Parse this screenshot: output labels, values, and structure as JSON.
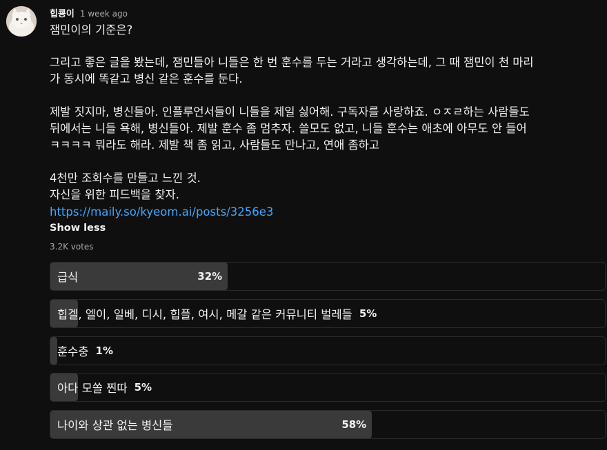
{
  "post": {
    "author": "힙쿙이",
    "time": "1 week ago",
    "lines": [
      {
        "text": "잼민이의 기준은?"
      },
      {
        "text": "그리고 좋은 글을 봤는데, 잼민들아 니들은 한 번 훈수를 두는 거라고 생각하는데, 그 때 잼민이 천 마리"
      },
      {
        "text": "가 동시에 똑같고 병신 같은 훈수를 둔다."
      },
      {
        "text": "제발 짓지마, 병신들아. 인플루언서들이 니들을 제일 싫어해. 구독자를 사랑하죠. ㅇㅈㄹ하는 사람들도"
      },
      {
        "text": "뒤에서는 니들 욕해, 병신들아. 제발 훈수 좀 멈추자. 쓸모도 없고, 니들 훈수는 애초에 아무도 안 들어"
      },
      {
        "text": "ㅋㅋㅋㅋ 뭐라도 해라. 제발 책 좀 읽고, 사람들도 만나고, 연애 좀하고"
      },
      {
        "text": "4천만 조회수를 만들고 느낀 것."
      },
      {
        "text": "자신을 위한 피드백을 찾자."
      }
    ],
    "link": "https://maily.so/kyeom.ai/posts/3256e3",
    "show_less": "Show less",
    "votes": "3.2K votes"
  },
  "poll": {
    "options": [
      {
        "label": "급식",
        "percent_text": "32%",
        "percent": 32
      },
      {
        "label": "힙겔, 엘이, 일베, 디시, 힙플, 여시, 메갈 같은 커뮤니티 벌레들",
        "percent_text": "5%",
        "percent": 5
      },
      {
        "label": "훈수충",
        "percent_text": "1%",
        "percent": 1
      },
      {
        "label": "아다 모쏠 찐따",
        "percent_text": "5%",
        "percent": 5
      },
      {
        "label": "나이와 상관 없는 병신들",
        "percent_text": "58%",
        "percent": 58
      }
    ]
  },
  "colors": {
    "background": "#0f0f0f",
    "link": "#3ea6ff",
    "poll_fill": "#3a3a3a",
    "poll_border": "#2a2a2a",
    "secondary_text": "#aaaaaa"
  },
  "icons": {
    "avatar": "cat-avatar"
  }
}
